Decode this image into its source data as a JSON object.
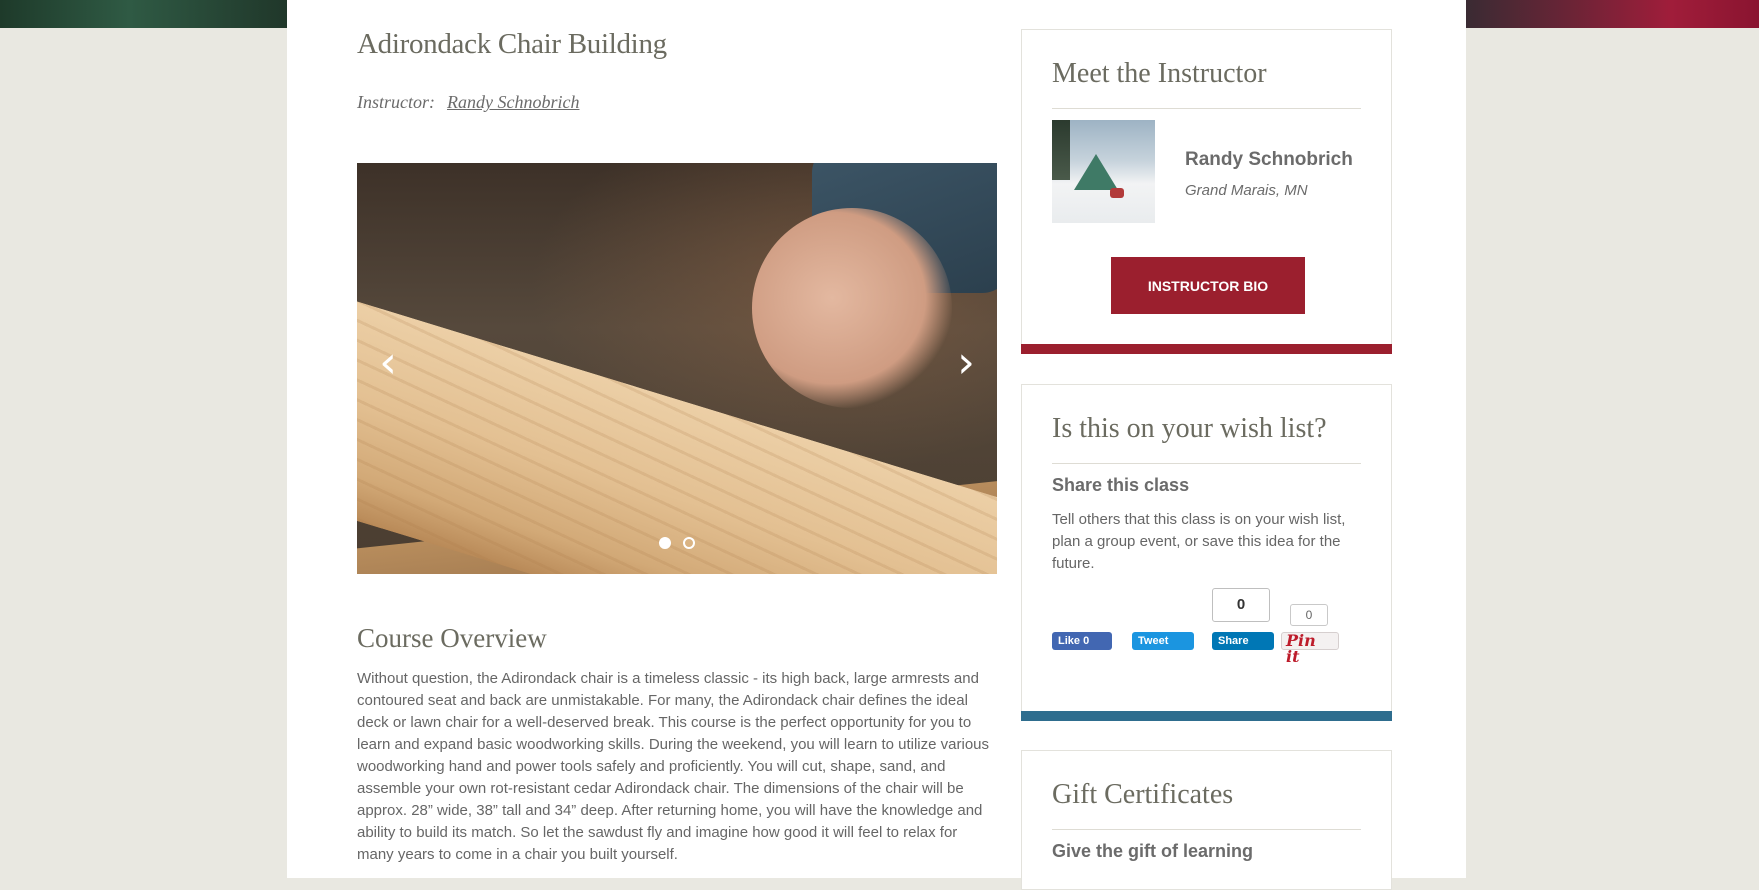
{
  "course": {
    "title": "Adirondack Chair Building",
    "instructor_label": "Instructor:",
    "instructor_link": "Randy Schnobrich"
  },
  "carousel": {
    "prev_icon": "chevron-left-icon",
    "next_icon": "chevron-right-icon",
    "prev_glyph": "‹",
    "next_glyph": "›",
    "slide_count": 2,
    "active_slide": 1
  },
  "overview": {
    "title": "Course Overview",
    "text": "Without question, the Adirondack chair is a timeless classic - its high back, large armrests and contoured seat and back are unmistakable. For many, the Adirondack chair defines the ideal deck or lawn chair for a well-deserved break. This course is the perfect opportunity for you to learn and expand basic woodworking skills. During the weekend, you will learn to utilize various woodworking hand and power tools safely and proficiently. You will cut, shape, sand, and assemble your own rot-resistant cedar Adirondack chair. The dimensions of the chair will be approx. 28” wide, 38” tall and 34” deep. After returning home, you will have the knowledge and ability to build its match. So let the sawdust fly and imagine how good it will feel to relax for many years to come in a chair you built yourself."
  },
  "sidebar": {
    "instructor_card": {
      "title": "Meet the Instructor",
      "name": "Randy Schnobrich",
      "location": "Grand Marais, MN",
      "button_label": "INSTRUCTOR BIO",
      "accent_color": "#9b1f2e"
    },
    "wish_card": {
      "title": "Is this on your wish list?",
      "subtitle": "Share this class",
      "text": "Tell others that this class is on your wish list, plan a group event, or save this idea for the future.",
      "accent_color": "#2e6d8e",
      "social": {
        "facebook_label": "Like 0",
        "twitter_label": "Tweet",
        "linkedin_label": "Share",
        "linkedin_count": "0",
        "pinterest_label": "Pin it",
        "pinterest_count": "0"
      }
    },
    "gift_card": {
      "title": "Gift Certificates",
      "subtitle": "Give the gift of learning"
    }
  }
}
